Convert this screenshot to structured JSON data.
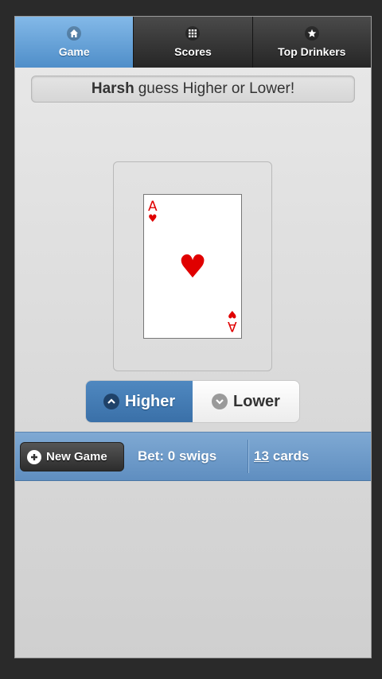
{
  "tabs": [
    {
      "label": "Game",
      "icon": "home-icon",
      "active": true
    },
    {
      "label": "Scores",
      "icon": "grid-icon",
      "active": false
    },
    {
      "label": "Top Drinkers",
      "icon": "star-icon",
      "active": false
    }
  ],
  "prompt": {
    "player": "Harsh",
    "message": "guess Higher or Lower!"
  },
  "card": {
    "rank": "A",
    "suit": "♥",
    "color": "#e00000"
  },
  "guess": {
    "higher_label": "Higher",
    "lower_label": "Lower",
    "selected": "Higher"
  },
  "footer": {
    "new_game_label": "New Game",
    "bet_text": "Bet: 0 swigs",
    "cards_count": "13",
    "cards_suffix": "cards"
  },
  "colors": {
    "accent": "#4f8ec9",
    "toolbar": "#6f9dcb"
  }
}
